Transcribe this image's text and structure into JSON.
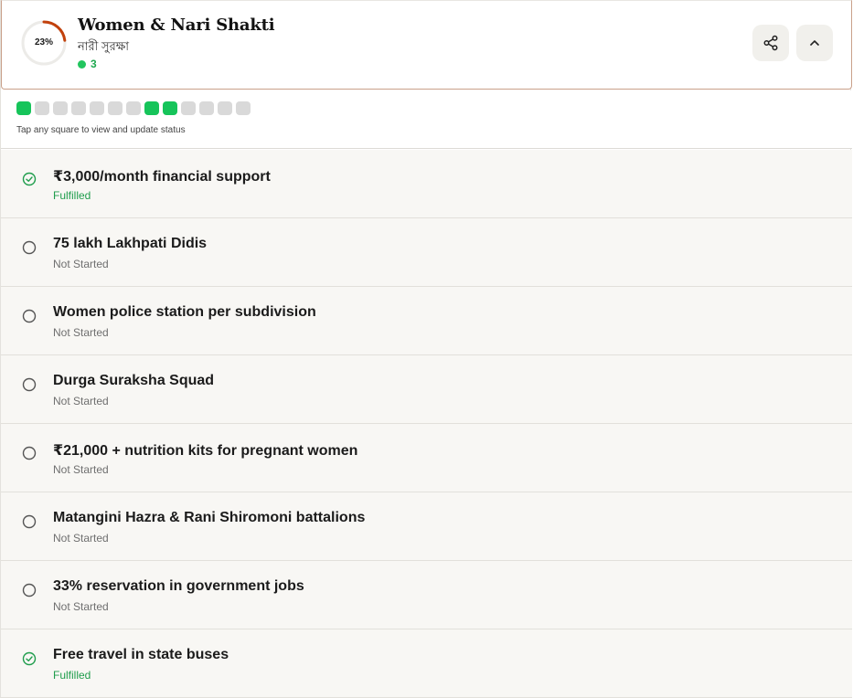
{
  "header": {
    "progress_label": "23%",
    "progress_fraction": 0.23,
    "title": "Women & Nari Shakti",
    "subtitle": "নারী সুরক্ষা",
    "fulfilled_count": "3",
    "share_icon": "share-icon",
    "collapse_icon": "chevron-up-icon"
  },
  "status_bar": {
    "squares": [
      "fulfilled",
      "not-started",
      "not-started",
      "not-started",
      "not-started",
      "not-started",
      "not-started",
      "fulfilled",
      "fulfilled",
      "not-started",
      "not-started",
      "not-started",
      "not-started"
    ],
    "hint": "Tap any square to view and update status"
  },
  "colors": {
    "accent": "#c2410c",
    "fulfilled": "#16c45a",
    "not_started": "#d9d9d9"
  },
  "items": [
    {
      "title": "₹3,000/month financial support",
      "status": "Fulfilled"
    },
    {
      "title": "75 lakh Lakhpati Didis",
      "status": "Not Started"
    },
    {
      "title": "Women police station per subdivision",
      "status": "Not Started"
    },
    {
      "title": "Durga Suraksha Squad",
      "status": "Not Started"
    },
    {
      "title": "₹21,000 + nutrition kits for pregnant women",
      "status": "Not Started"
    },
    {
      "title": "Matangini Hazra & Rani Shiromoni battalions",
      "status": "Not Started"
    },
    {
      "title": "33% reservation in government jobs",
      "status": "Not Started"
    },
    {
      "title": "Free travel in state buses",
      "status": "Fulfilled"
    }
  ]
}
